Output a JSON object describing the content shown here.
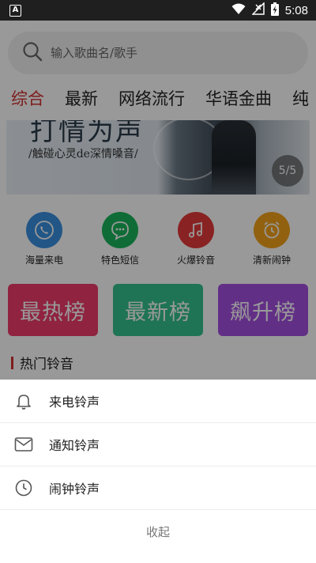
{
  "status_bar": {
    "app_badge": "A",
    "time": "5:08",
    "icons": [
      "wifi-icon",
      "no-signal-icon",
      "battery-charging-icon"
    ]
  },
  "search": {
    "placeholder": "输入歌曲名/歌手",
    "icon": "search-icon"
  },
  "tabs": [
    {
      "label": "综合",
      "active": true
    },
    {
      "label": "最新",
      "active": false
    },
    {
      "label": "网络流行",
      "active": false
    },
    {
      "label": "华语金曲",
      "active": false
    },
    {
      "label": "纯",
      "active": false
    }
  ],
  "banner": {
    "title": "打情为声",
    "subtitle": "/触碰心灵de深情嗓音/",
    "page_indicator": "5/5"
  },
  "quick_actions": [
    {
      "label": "海量来电",
      "icon": "phone-icon",
      "color": "#3a8fe0"
    },
    {
      "label": "特色短信",
      "icon": "chat-icon",
      "color": "#19b45a"
    },
    {
      "label": "火爆铃音",
      "icon": "music-note-icon",
      "color": "#e43a3a"
    },
    {
      "label": "清新闹钟",
      "icon": "alarm-clock-icon",
      "color": "#f3a21b"
    }
  ],
  "rank_cards": [
    {
      "label": "最热榜",
      "color": "#ee3b6b"
    },
    {
      "label": "最新榜",
      "color": "#32c28e"
    },
    {
      "label": "飙升榜",
      "color": "#a44fdf"
    }
  ],
  "section": {
    "title": "热门铃音"
  },
  "sheet": {
    "items": [
      {
        "label": "来电铃声",
        "icon": "bell-icon"
      },
      {
        "label": "通知铃声",
        "icon": "mail-icon"
      },
      {
        "label": "闹钟铃声",
        "icon": "clock-icon"
      }
    ],
    "close_label": "收起"
  }
}
